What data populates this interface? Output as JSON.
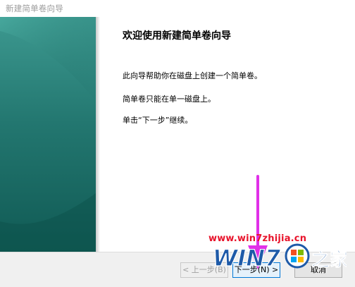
{
  "window": {
    "title": "新建简单卷向导"
  },
  "welcome": {
    "heading": "欢迎使用新建简单卷向导",
    "line1": "此向导帮助你在磁盘上创建一个简单卷。",
    "line2": "简单卷只能在单一磁盘上。",
    "line3": "单击“下一步”继续。"
  },
  "buttons": {
    "back": "< 上一步(B)",
    "next": "下一步(N) >",
    "cancel": "取消"
  },
  "watermark": {
    "url": "www.win7zhijia.cn",
    "logo_text": "WIN7",
    "logo_suffix": "之家"
  },
  "colors": {
    "panel_gradient_top": "#2f8b83",
    "panel_gradient_bottom": "#15635c",
    "watermark_red": "#e8132b",
    "logo_blue": "#1e5aa8",
    "arrow_magenta": "#e030e8"
  },
  "icons": {
    "arrow": "down-arrow-icon",
    "windows_logo": "windows-flag-icon"
  }
}
